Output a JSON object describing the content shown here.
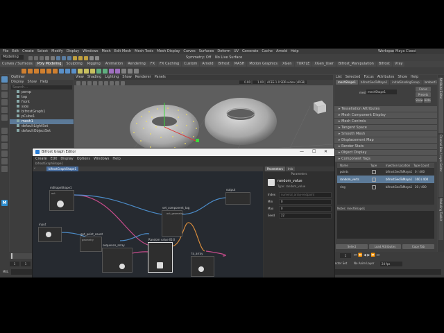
{
  "maya": {
    "menubar": [
      "File",
      "Edit",
      "Create",
      "Select",
      "Modify",
      "Display",
      "Windows",
      "Mesh",
      "Edit Mesh",
      "Mesh Tools",
      "Mesh Display",
      "Curves",
      "Surfaces",
      "Deform",
      "UV",
      "Generate",
      "Cache",
      "Arnold",
      "Help"
    ],
    "workspace_label": "Workspace:",
    "workspace_value": "Maya Classic",
    "mode_value": "Modeling",
    "symmetry_label": "Symmetry: Off",
    "no_live_surface": "No Live Surface",
    "shelf_tabs": [
      "Curves / Surfaces",
      "Poly Modeling",
      "Sculpting",
      "Rigging",
      "Animation",
      "Rendering",
      "FX",
      "FX Caching",
      "Custom",
      "Arnold",
      "Bifrost",
      "MASH",
      "Motion Graphics",
      "XGen",
      "TURTLE",
      "XGen_User",
      "Bifrost_Manipulation",
      "Bifrost",
      "Vray"
    ],
    "active_shelf_tab": "Poly Modeling"
  },
  "outliner": {
    "title": "Outliner",
    "menus": [
      "Display",
      "Show",
      "Help"
    ],
    "search_placeholder": "Search...",
    "items": [
      {
        "label": "persp",
        "selected": false
      },
      {
        "label": "top",
        "selected": false
      },
      {
        "label": "front",
        "selected": false
      },
      {
        "label": "side",
        "selected": false
      },
      {
        "label": "bifrostGraph1",
        "selected": false
      },
      {
        "label": "pCube1",
        "selected": false
      },
      {
        "label": "mesh1",
        "selected": true
      },
      {
        "label": "defaultLightSet",
        "selected": false
      },
      {
        "label": "defaultObjectSet",
        "selected": false
      }
    ]
  },
  "viewport": {
    "menus": [
      "View",
      "Shading",
      "Lighting",
      "Show",
      "Renderer",
      "Panels"
    ],
    "colorspace": "ACES 1.0 SDR-video (sRGB)",
    "value_1": "0.00",
    "value_2": "1.00"
  },
  "attribute_editor": {
    "tabs": [
      "List",
      "Selected",
      "Focus",
      "Attributes",
      "Show",
      "Help"
    ],
    "node_tabs": [
      "meshShape1",
      "bifrostGeoToMaya1",
      "initialShadingGroup",
      "lambert1"
    ],
    "node_name_label": "mesh:",
    "node_name_value": "meshShape1",
    "focus_button": "Focus",
    "presets_button": "Presets",
    "show_button": "Show",
    "hide_button": "Hide",
    "sections": [
      "Tessellation Attributes",
      "Mesh Component Display",
      "Mesh Controls",
      "Tangent Space",
      "Smooth Mesh",
      "Displacement Map",
      "Render Stats",
      "Object Display",
      "Component Tags"
    ],
    "tag_table": {
      "headers": [
        "Name",
        "Type",
        "Injection Location",
        "Type Count"
      ],
      "rows": [
        {
          "name": "points",
          "type": "",
          "location": "bifrostGeoToMaya1",
          "count": "0 / 400",
          "selected": false
        },
        {
          "name": "random_verts",
          "type": "",
          "location": "bifrostGeoToMaya1",
          "count": "160 / 400",
          "selected": true
        },
        {
          "name": "ring",
          "type": "",
          "location": "bifrostGeoToMaya1",
          "count": "20 / 400",
          "selected": false
        }
      ]
    },
    "notes_label": "Notes: meshShape1",
    "select_button": "Select",
    "load_attributes_button": "Load Attributes",
    "copy_tab_button": "Copy Tab"
  },
  "side_tabs": [
    "Attribute Editor",
    "Channel Box / Layer Editor",
    "Modeling Toolkit"
  ],
  "bifrost": {
    "window_title": "Bifrost Graph Editor",
    "menus": [
      "Create",
      "Edit",
      "Display",
      "Options",
      "Windows",
      "Help"
    ],
    "graph_path": "bifrostGraphShape1",
    "graph_tab": "bifrostGraphShape1",
    "panel_tabs": [
      "Parameters",
      "Info"
    ],
    "panel_sub_header": "Parameters",
    "selected_node_name": "random_value",
    "selected_node_type": "Type: random_value",
    "params": [
      {
        "label": "Index",
        "value": "numeral_array-endpoint"
      },
      {
        "label": "Min",
        "value": "0"
      },
      {
        "label": "Max",
        "value": "0"
      },
      {
        "label": "Seed",
        "value": "22"
      }
    ],
    "nodes": [
      {
        "id": "n1",
        "title": "mShapeShape1",
        "port": "out"
      },
      {
        "id": "n2",
        "title": "input",
        "port": ""
      },
      {
        "id": "n3",
        "title": "get_point_count",
        "port": "geometry"
      },
      {
        "id": "n4",
        "title": "sequence_array",
        "port": ""
      },
      {
        "id": "n5",
        "title": "Random value ID:0",
        "port": ""
      },
      {
        "id": "n6",
        "title": "set_component_tag",
        "port": "out_geometry"
      },
      {
        "id": "n7",
        "title": "output",
        "port": ""
      },
      {
        "id": "n8",
        "title": "to_array",
        "port": ""
      }
    ]
  },
  "timeline": {
    "start": "1",
    "end": "120",
    "current": "1",
    "no_character_set": "No Character Set",
    "no_anim_layer": "No Anim Layer",
    "fps": "24 fps",
    "mel_label": "MEL"
  }
}
